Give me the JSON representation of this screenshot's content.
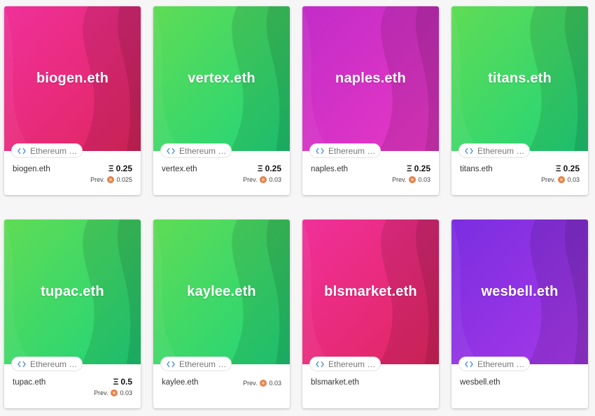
{
  "cards": [
    {
      "title": "biogen.eth",
      "name": "biogen.eth",
      "chip": "Ethereum Name Service",
      "price_symbol": "Ξ",
      "price": "0.25",
      "prev_label": "Prev.",
      "prev": "0.025",
      "colors": [
        "#f0309a",
        "#e0265e",
        "#c2249a"
      ]
    },
    {
      "title": "vertex.eth",
      "name": "vertex.eth",
      "chip": "Ethereum Name Service",
      "price_symbol": "Ξ",
      "price": "0.25",
      "prev_label": "Prev.",
      "prev": "0.03",
      "colors": [
        "#5fdc55",
        "#20d47a",
        "#17a858"
      ]
    },
    {
      "title": "naples.eth",
      "name": "naples.eth",
      "chip": "Ethereum Name Service",
      "price_symbol": "Ξ",
      "price": "0.25",
      "prev_label": "Prev.",
      "prev": "0.03",
      "colors": [
        "#c22cc8",
        "#e838c4",
        "#a0249a"
      ]
    },
    {
      "title": "titans.eth",
      "name": "titans.eth",
      "chip": "Ethereum Name Service",
      "price_symbol": "Ξ",
      "price": "0.25",
      "prev_label": "Prev.",
      "prev": "0.03",
      "colors": [
        "#5fdc55",
        "#20d47a",
        "#17a858"
      ]
    },
    {
      "title": "tupac.eth",
      "name": "tupac.eth",
      "chip": "Ethereum Name Service",
      "price_symbol": "Ξ",
      "price": "0.5",
      "prev_label": "Prev.",
      "prev": "0.03",
      "colors": [
        "#5fdc55",
        "#20d47a",
        "#17a858"
      ]
    },
    {
      "title": "kaylee.eth",
      "name": "kaylee.eth",
      "chip": "Ethereum Name Service",
      "price_symbol": "",
      "price": "",
      "prev_label": "Prev.",
      "prev": "0.03",
      "colors": [
        "#5fdc55",
        "#20d47a",
        "#17a858"
      ]
    },
    {
      "title": "blsmarket.eth",
      "name": "blsmarket.eth",
      "chip": "Ethereum Name Service",
      "price_symbol": "",
      "price": "",
      "prev_label": "",
      "prev": "",
      "colors": [
        "#f0309a",
        "#e0265e",
        "#c2249a"
      ]
    },
    {
      "title": "wesbell.eth",
      "name": "wesbell.eth",
      "chip": "Ethereum Name Service",
      "price_symbol": "",
      "price": "",
      "prev_label": "",
      "prev": "",
      "colors": [
        "#7a2ee0",
        "#a838e8",
        "#5a22b8"
      ]
    }
  ]
}
